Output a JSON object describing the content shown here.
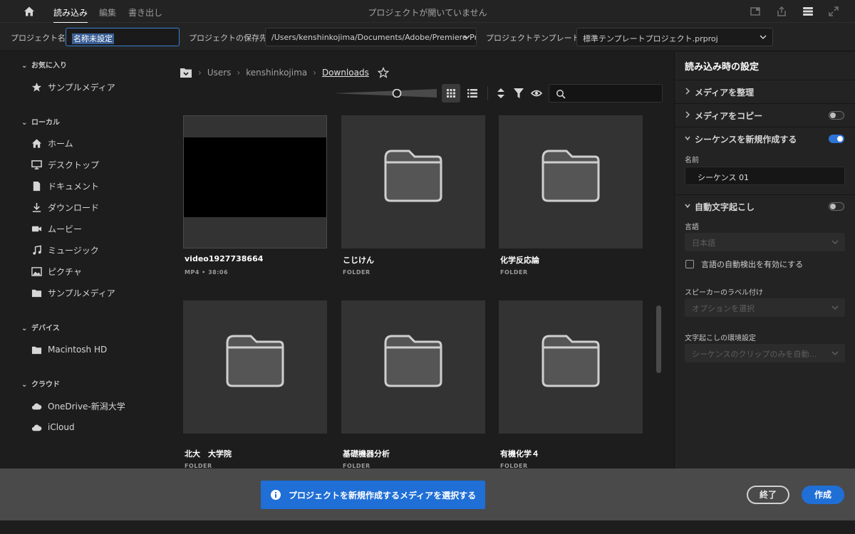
{
  "topbar": {
    "tabs": [
      "読み込み",
      "編集",
      "書き出し"
    ],
    "title": "プロジェクトが開いていません"
  },
  "project": {
    "name_label": "プロジェクト名",
    "name_value": "名称未設定",
    "location_label": "プロジェクトの保存先",
    "location_value": "/Users/kenshinkojima/Documents/Adobe/Premiere Pr...",
    "template_label": "プロジェクトテンプレート",
    "template_value": "標準テンプレートプロジェクト.prproj"
  },
  "sidebar": {
    "favorites_label": "お気に入り",
    "favorites": [
      "サンプルメディア"
    ],
    "local_label": "ローカル",
    "local": [
      "ホーム",
      "デスクトップ",
      "ドキュメント",
      "ダウンロード",
      "ムービー",
      "ミュージック",
      "ピクチャ",
      "サンプルメディア"
    ],
    "devices_label": "デバイス",
    "devices": [
      "Macintosh HD"
    ],
    "cloud_label": "クラウド",
    "cloud": [
      "OneDrive-新潟大学",
      "iCloud"
    ]
  },
  "breadcrumb": [
    "Users",
    "kenshinkojima",
    "Downloads"
  ],
  "tiles": [
    {
      "name": "video1927738664",
      "sub": "MP4 • 38:06"
    },
    {
      "name": "こじけん",
      "sub": "FOLDER"
    },
    {
      "name": "化学反応論",
      "sub": "FOLDER"
    },
    {
      "name": "北大　大学院",
      "sub": "FOLDER"
    },
    {
      "name": "基礎機器分析",
      "sub": "FOLDER"
    },
    {
      "name": "有機化学４",
      "sub": "FOLDER"
    }
  ],
  "settings": {
    "title": "読み込み時の設定",
    "organize_label": "メディアを整理",
    "copy_label": "メディアをコピー",
    "copy_enabled": false,
    "sequence_label": "シーケンスを新規作成する",
    "sequence_enabled": true,
    "name_label": "名前",
    "name_value": "シーケンス 01",
    "transcribe_label": "自動文字起こし",
    "transcribe_enabled": false,
    "language_label": "言語",
    "language_value": "日本語",
    "autodetect_label": "言語の自動検出を有効にする",
    "autodetect_checked": false,
    "speaker_label": "スピーカーのラベル付け",
    "speaker_value": "オプションを選択",
    "prefs_label": "文字起こしの環境設定",
    "prefs_value": "シーケンスのクリップのみを自動…"
  },
  "footer": {
    "cta": "プロジェクトを新規作成するメディアを選択する",
    "close": "終了",
    "create": "作成"
  },
  "colors": {
    "accent": "#1f6fd6",
    "background": "#1d1d1d",
    "tile": "#333333",
    "footer": "#4a4a4a"
  }
}
